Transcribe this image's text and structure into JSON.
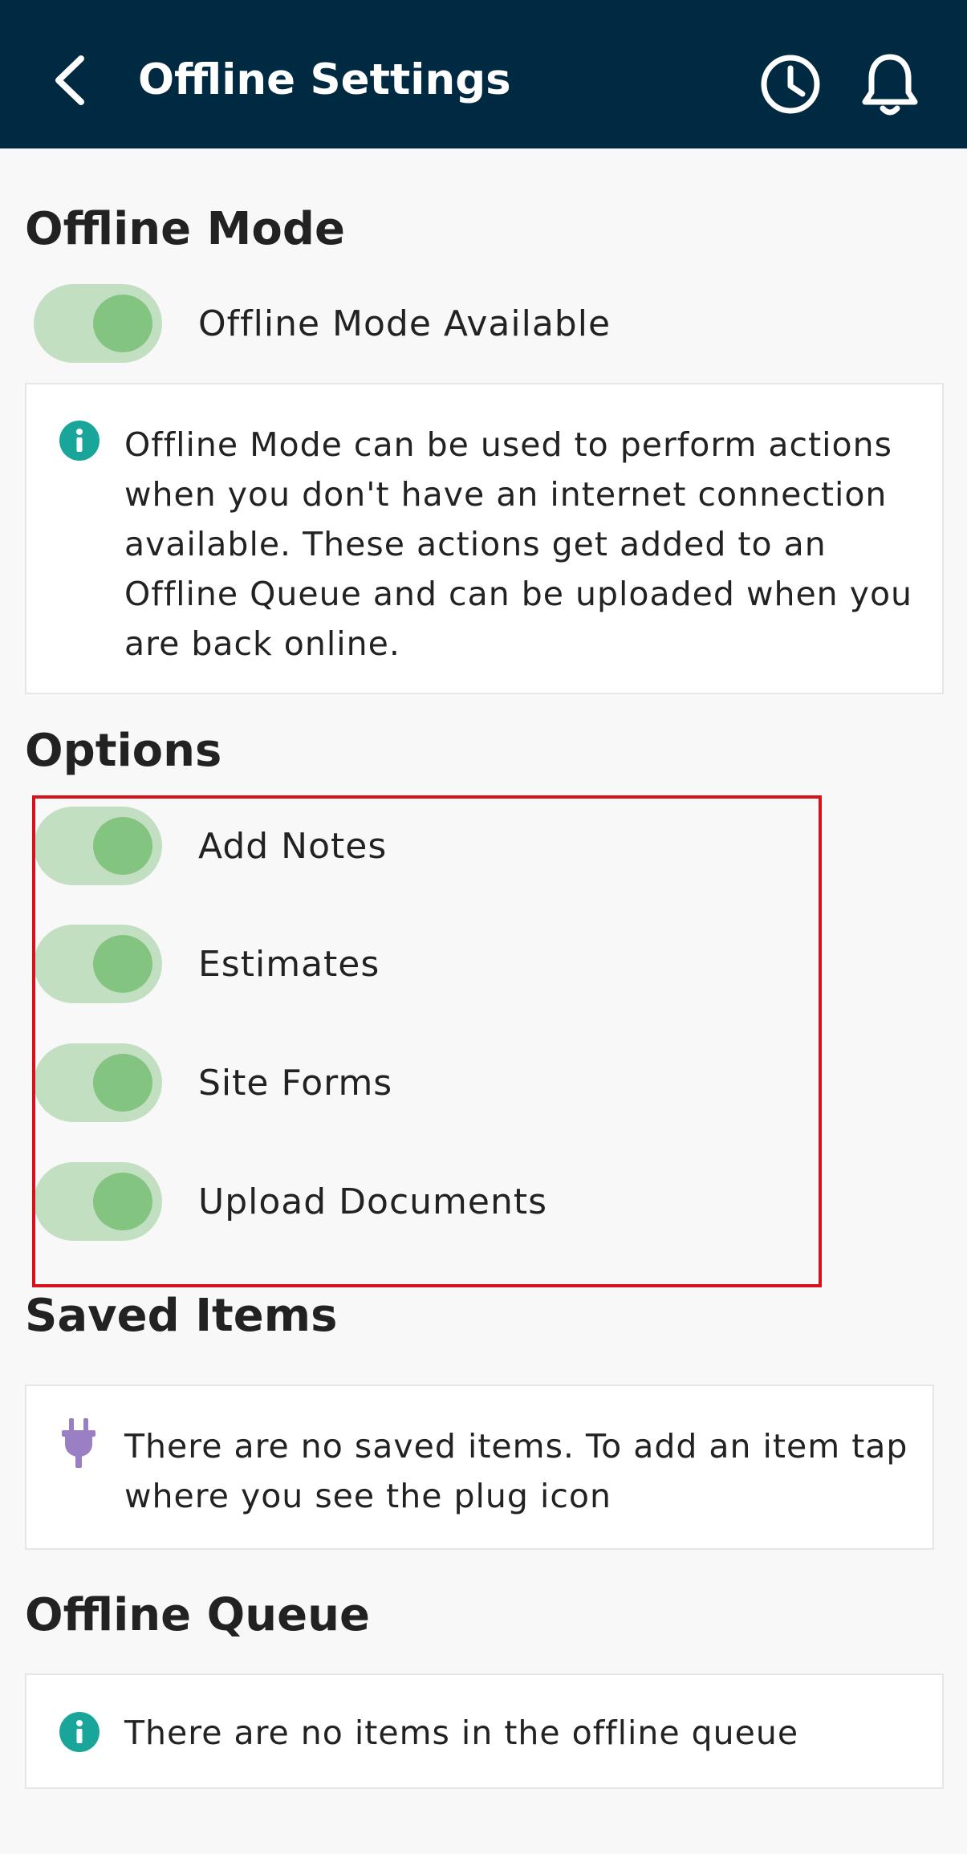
{
  "header": {
    "title": "Offline Settings",
    "back_icon": "chevron-left-icon",
    "history_icon": "clock-icon",
    "notifications_icon": "bell-icon",
    "background": "#002942"
  },
  "offline_mode": {
    "title": "Offline Mode",
    "toggle_label": "Offline Mode Available",
    "toggle_on": true,
    "info_icon": "info-icon",
    "info_text": "Offline Mode can be used to perform actions when you don't have an internet connection available. These actions get added to an Offline Queue and can be uploaded when you are back online."
  },
  "options": {
    "title": "Options",
    "items": [
      {
        "label": "Add Notes",
        "on": true
      },
      {
        "label": "Estimates",
        "on": true
      },
      {
        "label": "Site Forms",
        "on": true
      },
      {
        "label": "Upload Documents",
        "on": true
      }
    ]
  },
  "saved_items": {
    "title": "Saved Items",
    "icon": "plug-icon",
    "empty_text": "There are no saved items. To add an item tap where you see the plug icon"
  },
  "offline_queue": {
    "title": "Offline Queue",
    "icon": "info-icon",
    "empty_text": "There are no items in the offline queue"
  },
  "colors": {
    "toggle_track": "#c3dfc2",
    "toggle_thumb": "#84c481",
    "info_icon": "#1aa59a",
    "plug_icon": "#9b7fc4",
    "highlight": "#d8121c"
  }
}
